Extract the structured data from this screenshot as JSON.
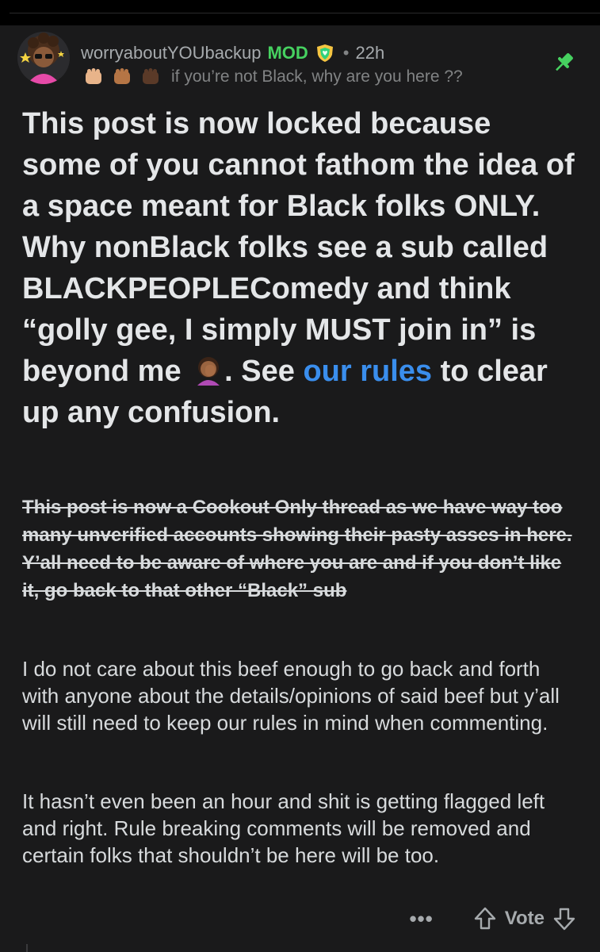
{
  "post": {
    "username": "worryaboutYOUbackup",
    "mod_badge": "MOD",
    "separator": "•",
    "age": "22h",
    "flair_text": "if you’re not Black, why are you here ??",
    "flair_icons": [
      "fist-light-icon",
      "fist-medium-icon",
      "fist-dark-icon"
    ],
    "pinned_icon": "pin-icon"
  },
  "body": {
    "headline_part1": "This post is now locked because some of you cannot fathom the idea of a space meant for Black folks ONLY. Why nonBlack folks see a sub called BLACKPEOPLEComedy and think “golly gee, I simply MUST join in” is beyond me",
    "headline_part2": ". See",
    "headline_link": "our rules",
    "headline_part3": "to clear up any confusion.",
    "struck_paragraph": "This post is now a Cookout Only thread as we have way too many unverified accounts showing their pasty asses in here. Y’all need to be aware of where you are and if you don’t like it, go back to that other “Black” sub",
    "paragraph_1": "I do not care about this beef enough to go back and forth with anyone about the details/opinions of said beef but y’all will still need to keep our rules in mind when commenting.",
    "paragraph_2": "It hasn’t even been an hour and shit is getting flagged left and right. Rule breaking comments will be removed and certain folks that shouldn’t be here will be too."
  },
  "actions": {
    "more_label": "•••",
    "vote_label": "Vote"
  },
  "colors": {
    "background": "#1a1a1b",
    "mod_green": "#46d160",
    "link_blue": "#3a8eed",
    "muted_text": "#818384"
  }
}
